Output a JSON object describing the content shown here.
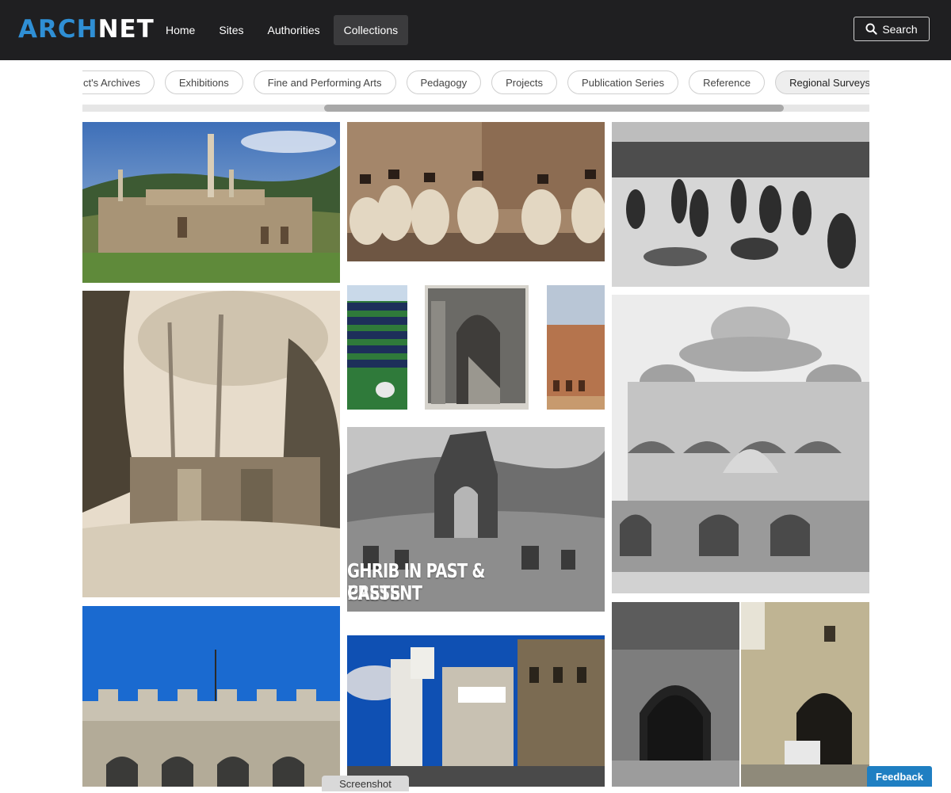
{
  "header": {
    "logo": {
      "part1": "ARCH",
      "part2": "NET"
    },
    "nav": [
      {
        "label": "Home"
      },
      {
        "label": "Sites"
      },
      {
        "label": "Authorities"
      },
      {
        "label": "Collections",
        "active": true
      }
    ],
    "search_label": "Search"
  },
  "chips": [
    {
      "label": "ct's Archives"
    },
    {
      "label": "Exhibitions"
    },
    {
      "label": "Fine and Performing Arts"
    },
    {
      "label": "Pedagogy"
    },
    {
      "label": "Projects"
    },
    {
      "label": "Publication Series"
    },
    {
      "label": "Reference"
    },
    {
      "label": "Regional Surveys",
      "active": true
    }
  ],
  "scrollbar": {
    "position_fraction": 0.31
  },
  "gallery": {
    "overlay_line1": "GHRIB IN PAST & PRESENT",
    "overlay_line2": "CASTS"
  },
  "footer": {
    "screenshot_tab": "Screenshot",
    "feedback_label": "Feedback"
  },
  "colors": {
    "topbar": "#1f1f21",
    "logo_accent": "#2f8fd5",
    "feedback": "#1f7fc2"
  }
}
